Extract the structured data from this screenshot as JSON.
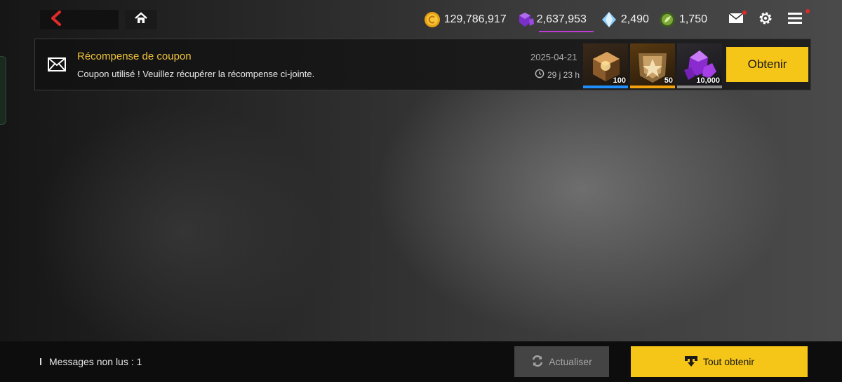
{
  "icons": {
    "back": "back-arrow-icon",
    "home": "home-icon",
    "gold": "gold-coin-icon",
    "crystal": "purple-crystal-icon",
    "diamond": "blue-diamond-icon",
    "energy": "green-energy-icon",
    "mail": "mail-icon",
    "settings": "gear-icon",
    "menu": "hamburger-menu-icon",
    "envelope": "envelope-icon",
    "clock": "clock-icon",
    "refresh": "refresh-icon",
    "claim_all": "download-tray-icon"
  },
  "resources": {
    "gold": "129,786,917",
    "crystal": "2,637,953",
    "diamond": "2,490",
    "energy": "1,750"
  },
  "mail": {
    "title": "Récompense de coupon",
    "body": "Coupon utilisé ! Veuillez récupérer la récompense ci-jointe.",
    "date": "2025-04-21",
    "expiry": "29 j 23 h",
    "rewards": [
      {
        "icon": "bronze-cube-icon",
        "qty": "100",
        "color": "#1f8fff"
      },
      {
        "icon": "gold-crest-icon",
        "qty": "50",
        "color": "#f2a20c"
      },
      {
        "icon": "purple-crystal-cluster-icon",
        "qty": "10,000",
        "color": "#8a8a8a"
      }
    ],
    "claim_label": "Obtenir"
  },
  "footer": {
    "unread": "Messages non lus : 1",
    "refresh_label": "Actualiser",
    "claim_all_label": "Tout obtenir"
  },
  "colors": {
    "accent": "#f5c518",
    "title": "#f0c33a",
    "notification": "#e02a2a",
    "crystal_bar": "#c03ad6"
  }
}
